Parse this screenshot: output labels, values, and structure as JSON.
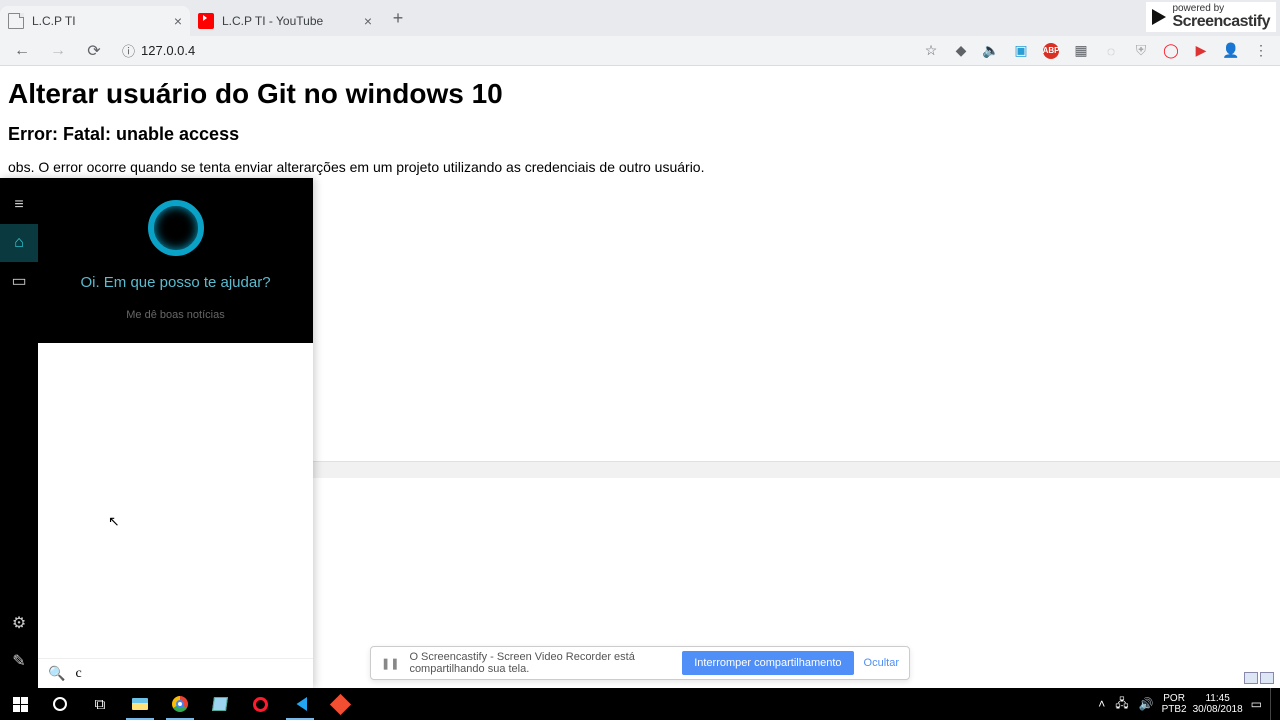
{
  "browser": {
    "tabs": [
      {
        "title": "L.C.P TI",
        "active": true,
        "favicon": "page"
      },
      {
        "title": "L.C.P TI - YouTube",
        "active": false,
        "favicon": "youtube"
      }
    ],
    "address": {
      "info_icon": "ⓘ",
      "url": "127.0.0.4"
    }
  },
  "screencastify": {
    "powered": "powered by",
    "brand": "Screencastify"
  },
  "page": {
    "h1": "Alterar usuário do Git no windows 10",
    "h2": "Error: Fatal: unable access",
    "p": "obs. O error ocorre quando se tenta enviar alterarções em um projeto utilizando as credenciais de outro usuário."
  },
  "cortana": {
    "greeting": "Oi. Em que posso te ajudar?",
    "suggestion": "Me dê boas notícias",
    "search_value": "c"
  },
  "share_bar": {
    "message": "O Screencastify - Screen Video Recorder está compartilhando sua tela.",
    "stop": "Interromper compartilhamento",
    "hide": "Ocultar"
  },
  "tray": {
    "lang1": "POR",
    "lang2": "PTB2",
    "time": "11:45",
    "date": "30/08/2018"
  },
  "ext_abp": "ABP"
}
